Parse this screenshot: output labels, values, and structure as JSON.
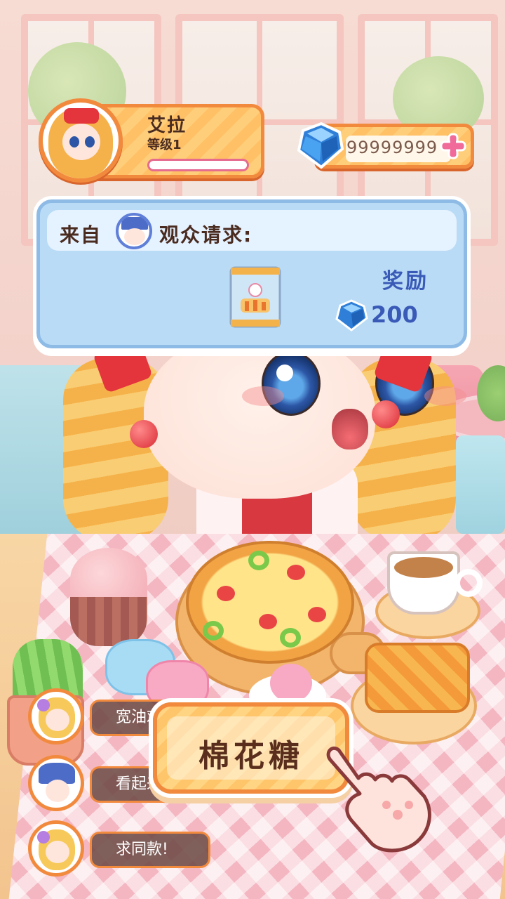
{
  "player": {
    "name": "艾拉",
    "level": "等级1",
    "xp_fraction": 0.0
  },
  "currency": {
    "gems": "99999999",
    "add_icon": "plus-icon"
  },
  "request": {
    "from_label": "来自",
    "text": "观众请求:",
    "reward_label": "奖励",
    "reward_value": "200",
    "item_icon": "snack-bag-icon"
  },
  "chat": [
    {
      "text": "宽油鸡",
      "avatar": "blonde-girl"
    },
    {
      "text": "看起来",
      "avatar": "guard"
    },
    {
      "text": "求同款!",
      "avatar": "blonde-girl"
    }
  ],
  "answer": {
    "label": "棉花糖"
  },
  "colors": {
    "accent_orange": "#f28a3e",
    "panel_blue": "#b9dbf5",
    "reward_blue": "#3a5ab8",
    "text_brown": "#4a2b20"
  }
}
